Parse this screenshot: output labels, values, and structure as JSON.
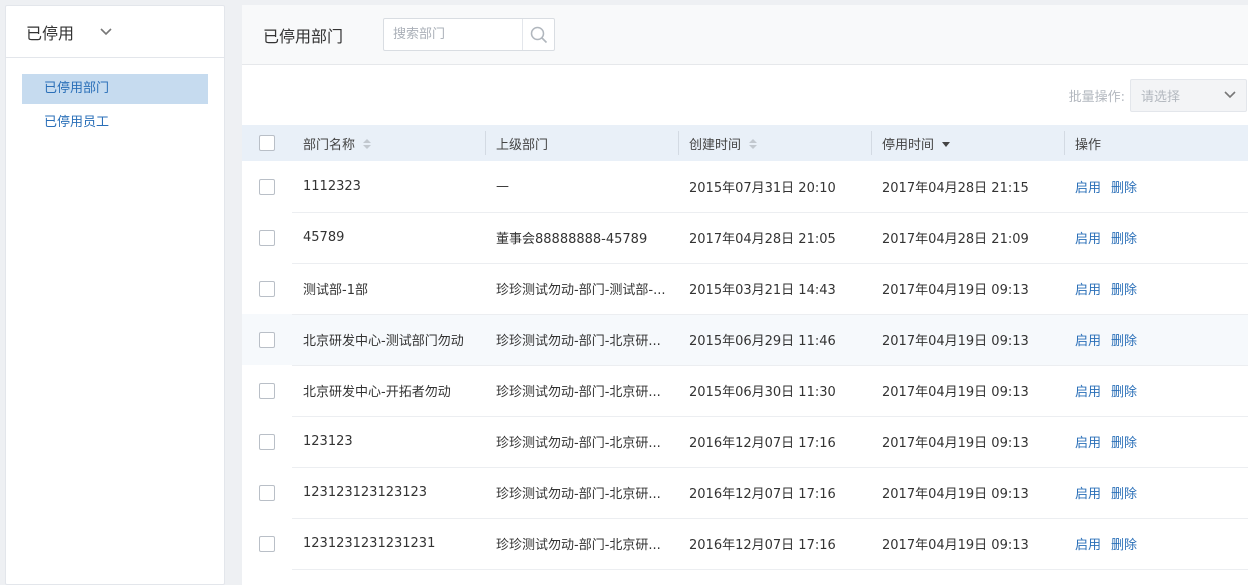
{
  "sidebar": {
    "title": "已停用",
    "items": [
      {
        "label": "已停用部门",
        "active": true
      },
      {
        "label": "已停用员工",
        "active": false
      }
    ]
  },
  "header": {
    "title": "已停用部门",
    "search_placeholder": "搜索部门"
  },
  "bulk": {
    "label": "批量操作:",
    "select_value": "请选择"
  },
  "table": {
    "columns": [
      "部门名称",
      "上级部门",
      "创建时间",
      "停用时间",
      "操作"
    ],
    "actions": [
      "启用",
      "删除"
    ],
    "rows": [
      {
        "name": "1112323",
        "parent": "—",
        "created": "2015年07月31日 20:10",
        "disabled": "2017年04月28日 21:15"
      },
      {
        "name": "45789",
        "parent": "董事会88888888-45789",
        "created": "2017年04月28日 21:05",
        "disabled": "2017年04月28日 21:09"
      },
      {
        "name": "测试部-1部",
        "parent": "珍珍测试勿动-部门-测试部-...",
        "created": "2015年03月21日 14:43",
        "disabled": "2017年04月19日 09:13"
      },
      {
        "name": "北京研发中心-测试部门勿动",
        "parent": "珍珍测试勿动-部门-北京研...",
        "created": "2015年06月29日 11:46",
        "disabled": "2017年04月19日 09:13"
      },
      {
        "name": "北京研发中心-开拓者勿动",
        "parent": "珍珍测试勿动-部门-北京研...",
        "created": "2015年06月30日 11:30",
        "disabled": "2017年04月19日 09:13"
      },
      {
        "name": "123123",
        "parent": "珍珍测试勿动-部门-北京研...",
        "created": "2016年12月07日 17:16",
        "disabled": "2017年04月19日 09:13"
      },
      {
        "name": "123123123123123",
        "parent": "珍珍测试勿动-部门-北京研...",
        "created": "2016年12月07日 17:16",
        "disabled": "2017年04月19日 09:13"
      },
      {
        "name": "1231231231231231",
        "parent": "珍珍测试勿动-部门-北京研...",
        "created": "2016年12月07日 17:16",
        "disabled": "2017年04月19日 09:13"
      }
    ]
  }
}
